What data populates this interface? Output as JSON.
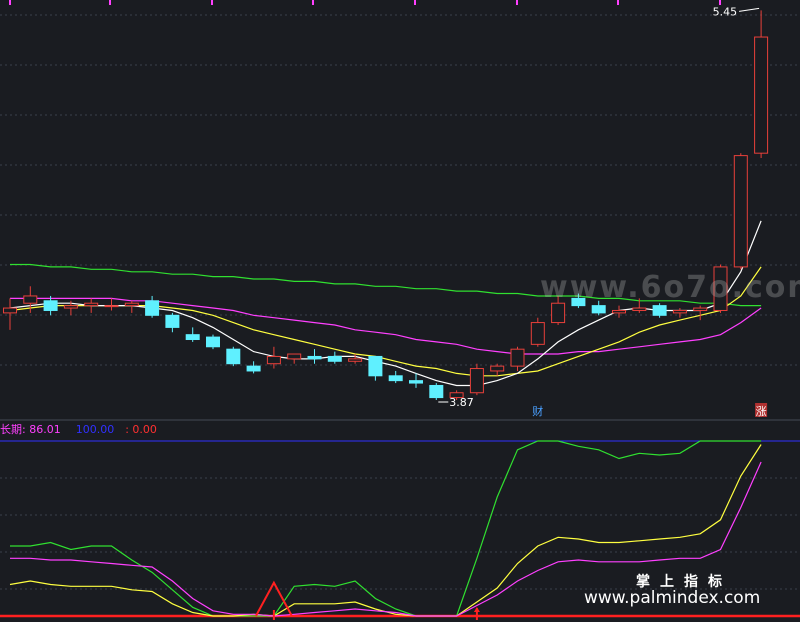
{
  "chart_data": [
    {
      "type": "candlestick",
      "panel": "price",
      "price_labels": {
        "high": "5.45",
        "low": "3.87"
      },
      "markers": [
        {
          "text": "财",
          "index": 26,
          "color": "#4aa0ff"
        },
        {
          "text": "涨",
          "index": 37,
          "color": "#ffffff",
          "bg": "#b03030"
        }
      ],
      "colors": {
        "up": "#e8403a",
        "down": "#5ff0ff",
        "ma5": "#ffffff",
        "ma10": "#ffff40",
        "ma20": "#ff40ff",
        "ma60": "#30e030"
      },
      "candles": [
        {
          "o": 4.2,
          "h": 4.26,
          "l": 4.13,
          "c": 4.22
        },
        {
          "o": 4.24,
          "h": 4.31,
          "l": 4.2,
          "c": 4.27
        },
        {
          "o": 4.25,
          "h": 4.27,
          "l": 4.19,
          "c": 4.21
        },
        {
          "o": 4.22,
          "h": 4.25,
          "l": 4.19,
          "c": 4.23
        },
        {
          "o": 4.23,
          "h": 4.26,
          "l": 4.2,
          "c": 4.24
        },
        {
          "o": 4.23,
          "h": 4.26,
          "l": 4.21,
          "c": 4.23
        },
        {
          "o": 4.23,
          "h": 4.25,
          "l": 4.2,
          "c": 4.24
        },
        {
          "o": 4.25,
          "h": 4.27,
          "l": 4.18,
          "c": 4.19
        },
        {
          "o": 4.19,
          "h": 4.2,
          "l": 4.12,
          "c": 4.14
        },
        {
          "o": 4.11,
          "h": 4.14,
          "l": 4.08,
          "c": 4.09
        },
        {
          "o": 4.1,
          "h": 4.11,
          "l": 4.05,
          "c": 4.06
        },
        {
          "o": 4.05,
          "h": 4.06,
          "l": 3.98,
          "c": 3.99
        },
        {
          "o": 3.98,
          "h": 4.0,
          "l": 3.95,
          "c": 3.96
        },
        {
          "o": 3.99,
          "h": 4.06,
          "l": 3.97,
          "c": 4.02
        },
        {
          "o": 4.01,
          "h": 4.03,
          "l": 3.99,
          "c": 4.03
        },
        {
          "o": 4.02,
          "h": 4.05,
          "l": 3.99,
          "c": 4.01
        },
        {
          "o": 4.02,
          "h": 4.04,
          "l": 3.99,
          "c": 4.0
        },
        {
          "o": 4.0,
          "h": 4.03,
          "l": 3.99,
          "c": 4.01
        },
        {
          "o": 4.02,
          "h": 4.02,
          "l": 3.92,
          "c": 3.94
        },
        {
          "o": 3.94,
          "h": 3.96,
          "l": 3.91,
          "c": 3.92
        },
        {
          "o": 3.92,
          "h": 3.95,
          "l": 3.89,
          "c": 3.91
        },
        {
          "o": 3.9,
          "h": 3.91,
          "l": 3.84,
          "c": 3.85
        },
        {
          "o": 3.85,
          "h": 3.88,
          "l": 3.84,
          "c": 3.87
        },
        {
          "o": 3.87,
          "h": 3.99,
          "l": 3.86,
          "c": 3.97
        },
        {
          "o": 3.96,
          "h": 3.99,
          "l": 3.94,
          "c": 3.98
        },
        {
          "o": 3.98,
          "h": 4.06,
          "l": 3.96,
          "c": 4.05
        },
        {
          "o": 4.07,
          "h": 4.18,
          "l": 4.06,
          "c": 4.16
        },
        {
          "o": 4.16,
          "h": 4.27,
          "l": 4.15,
          "c": 4.24
        },
        {
          "o": 4.26,
          "h": 4.28,
          "l": 4.22,
          "c": 4.23
        },
        {
          "o": 4.23,
          "h": 4.25,
          "l": 4.19,
          "c": 4.2
        },
        {
          "o": 4.2,
          "h": 4.23,
          "l": 4.18,
          "c": 4.21
        },
        {
          "o": 4.21,
          "h": 4.26,
          "l": 4.2,
          "c": 4.22
        },
        {
          "o": 4.23,
          "h": 4.24,
          "l": 4.18,
          "c": 4.19
        },
        {
          "o": 4.2,
          "h": 4.22,
          "l": 4.18,
          "c": 4.21
        },
        {
          "o": 4.21,
          "h": 4.23,
          "l": 4.17,
          "c": 4.22
        },
        {
          "o": 4.21,
          "h": 4.4,
          "l": 4.2,
          "c": 4.39
        },
        {
          "o": 4.39,
          "h": 4.86,
          "l": 4.38,
          "c": 4.85
        },
        {
          "o": 4.86,
          "h": 5.45,
          "l": 4.84,
          "c": 5.34
        }
      ],
      "ma5": [
        4.22,
        4.23,
        4.24,
        4.24,
        4.23,
        4.23,
        4.23,
        4.22,
        4.21,
        4.18,
        4.14,
        4.09,
        4.04,
        4.02,
        4.01,
        4.01,
        4.02,
        4.02,
        4.0,
        3.98,
        3.95,
        3.92,
        3.9,
        3.9,
        3.92,
        3.95,
        4.01,
        4.08,
        4.13,
        4.17,
        4.21,
        4.22,
        4.21,
        4.21,
        4.21,
        4.24,
        4.37,
        4.58
      ],
      "ma10": [
        4.21,
        4.22,
        4.23,
        4.23,
        4.23,
        4.23,
        4.23,
        4.23,
        4.22,
        4.21,
        4.19,
        4.16,
        4.13,
        4.11,
        4.09,
        4.07,
        4.05,
        4.03,
        4.02,
        4.0,
        3.98,
        3.97,
        3.95,
        3.94,
        3.94,
        3.95,
        3.96,
        3.99,
        4.02,
        4.05,
        4.08,
        4.12,
        4.15,
        4.17,
        4.19,
        4.21,
        4.27,
        4.39
      ],
      "ma20": [
        4.26,
        4.26,
        4.26,
        4.26,
        4.26,
        4.26,
        4.25,
        4.25,
        4.24,
        4.23,
        4.22,
        4.21,
        4.19,
        4.18,
        4.17,
        4.16,
        4.15,
        4.13,
        4.12,
        4.11,
        4.09,
        4.08,
        4.07,
        4.05,
        4.04,
        4.03,
        4.03,
        4.03,
        4.04,
        4.04,
        4.05,
        4.06,
        4.07,
        4.08,
        4.09,
        4.11,
        4.16,
        4.22
      ],
      "ma60": [
        4.4,
        4.4,
        4.39,
        4.39,
        4.38,
        4.38,
        4.37,
        4.37,
        4.36,
        4.36,
        4.35,
        4.35,
        4.34,
        4.34,
        4.33,
        4.33,
        4.32,
        4.32,
        4.31,
        4.31,
        4.3,
        4.3,
        4.29,
        4.29,
        4.28,
        4.28,
        4.27,
        4.27,
        4.27,
        4.26,
        4.26,
        4.25,
        4.25,
        4.25,
        4.24,
        4.24,
        4.23,
        4.23
      ]
    },
    {
      "type": "line",
      "panel": "indicator",
      "legend": [
        {
          "text": "长期: 86.01",
          "color": "#ff40ff"
        },
        {
          "text": "100.00",
          "color": "#3030ff"
        },
        {
          "text": ": 0.00",
          "color": "#ff3030"
        }
      ],
      "ylim": [
        0,
        100
      ],
      "reference_lines": [
        {
          "value": 100,
          "color": "#3030ff"
        },
        {
          "value": 0,
          "color": "#ff2020"
        }
      ],
      "series": [
        {
          "color": "#30e030",
          "values": [
            40,
            40,
            42,
            38,
            40,
            40,
            32,
            25,
            15,
            5,
            0,
            0,
            0,
            0,
            17,
            18,
            17,
            20,
            10,
            4,
            0,
            0,
            0,
            33,
            68,
            95,
            100,
            100,
            97,
            95,
            90,
            93,
            92,
            93,
            100,
            100,
            100,
            100
          ]
        },
        {
          "color": "#ffff40",
          "values": [
            18,
            20,
            18,
            17,
            17,
            17,
            15,
            14,
            7,
            2,
            0,
            0,
            1,
            0,
            7,
            7,
            7,
            8,
            4,
            1,
            0,
            0,
            0,
            8,
            16,
            30,
            40,
            45,
            44,
            42,
            42,
            43,
            44,
            45,
            47,
            55,
            80,
            98
          ]
        },
        {
          "color": "#ff40ff",
          "values": [
            33,
            33,
            32,
            32,
            31,
            30,
            29,
            28,
            20,
            10,
            3,
            1,
            1,
            0,
            1,
            2,
            3,
            4,
            3,
            2,
            0,
            0,
            0,
            6,
            12,
            20,
            26,
            31,
            32,
            31,
            31,
            31,
            32,
            33,
            33,
            38,
            62,
            88
          ]
        }
      ],
      "signals": [
        {
          "index": 13,
          "type": "triangle",
          "color": "#ff2020"
        },
        {
          "index": 23,
          "type": "arrow",
          "color": "#ff2020"
        }
      ]
    }
  ],
  "watermark": {
    "line1": "掌上指标",
    "line2": "www.palmindex.com",
    "mid": "www.6o7o.com"
  }
}
